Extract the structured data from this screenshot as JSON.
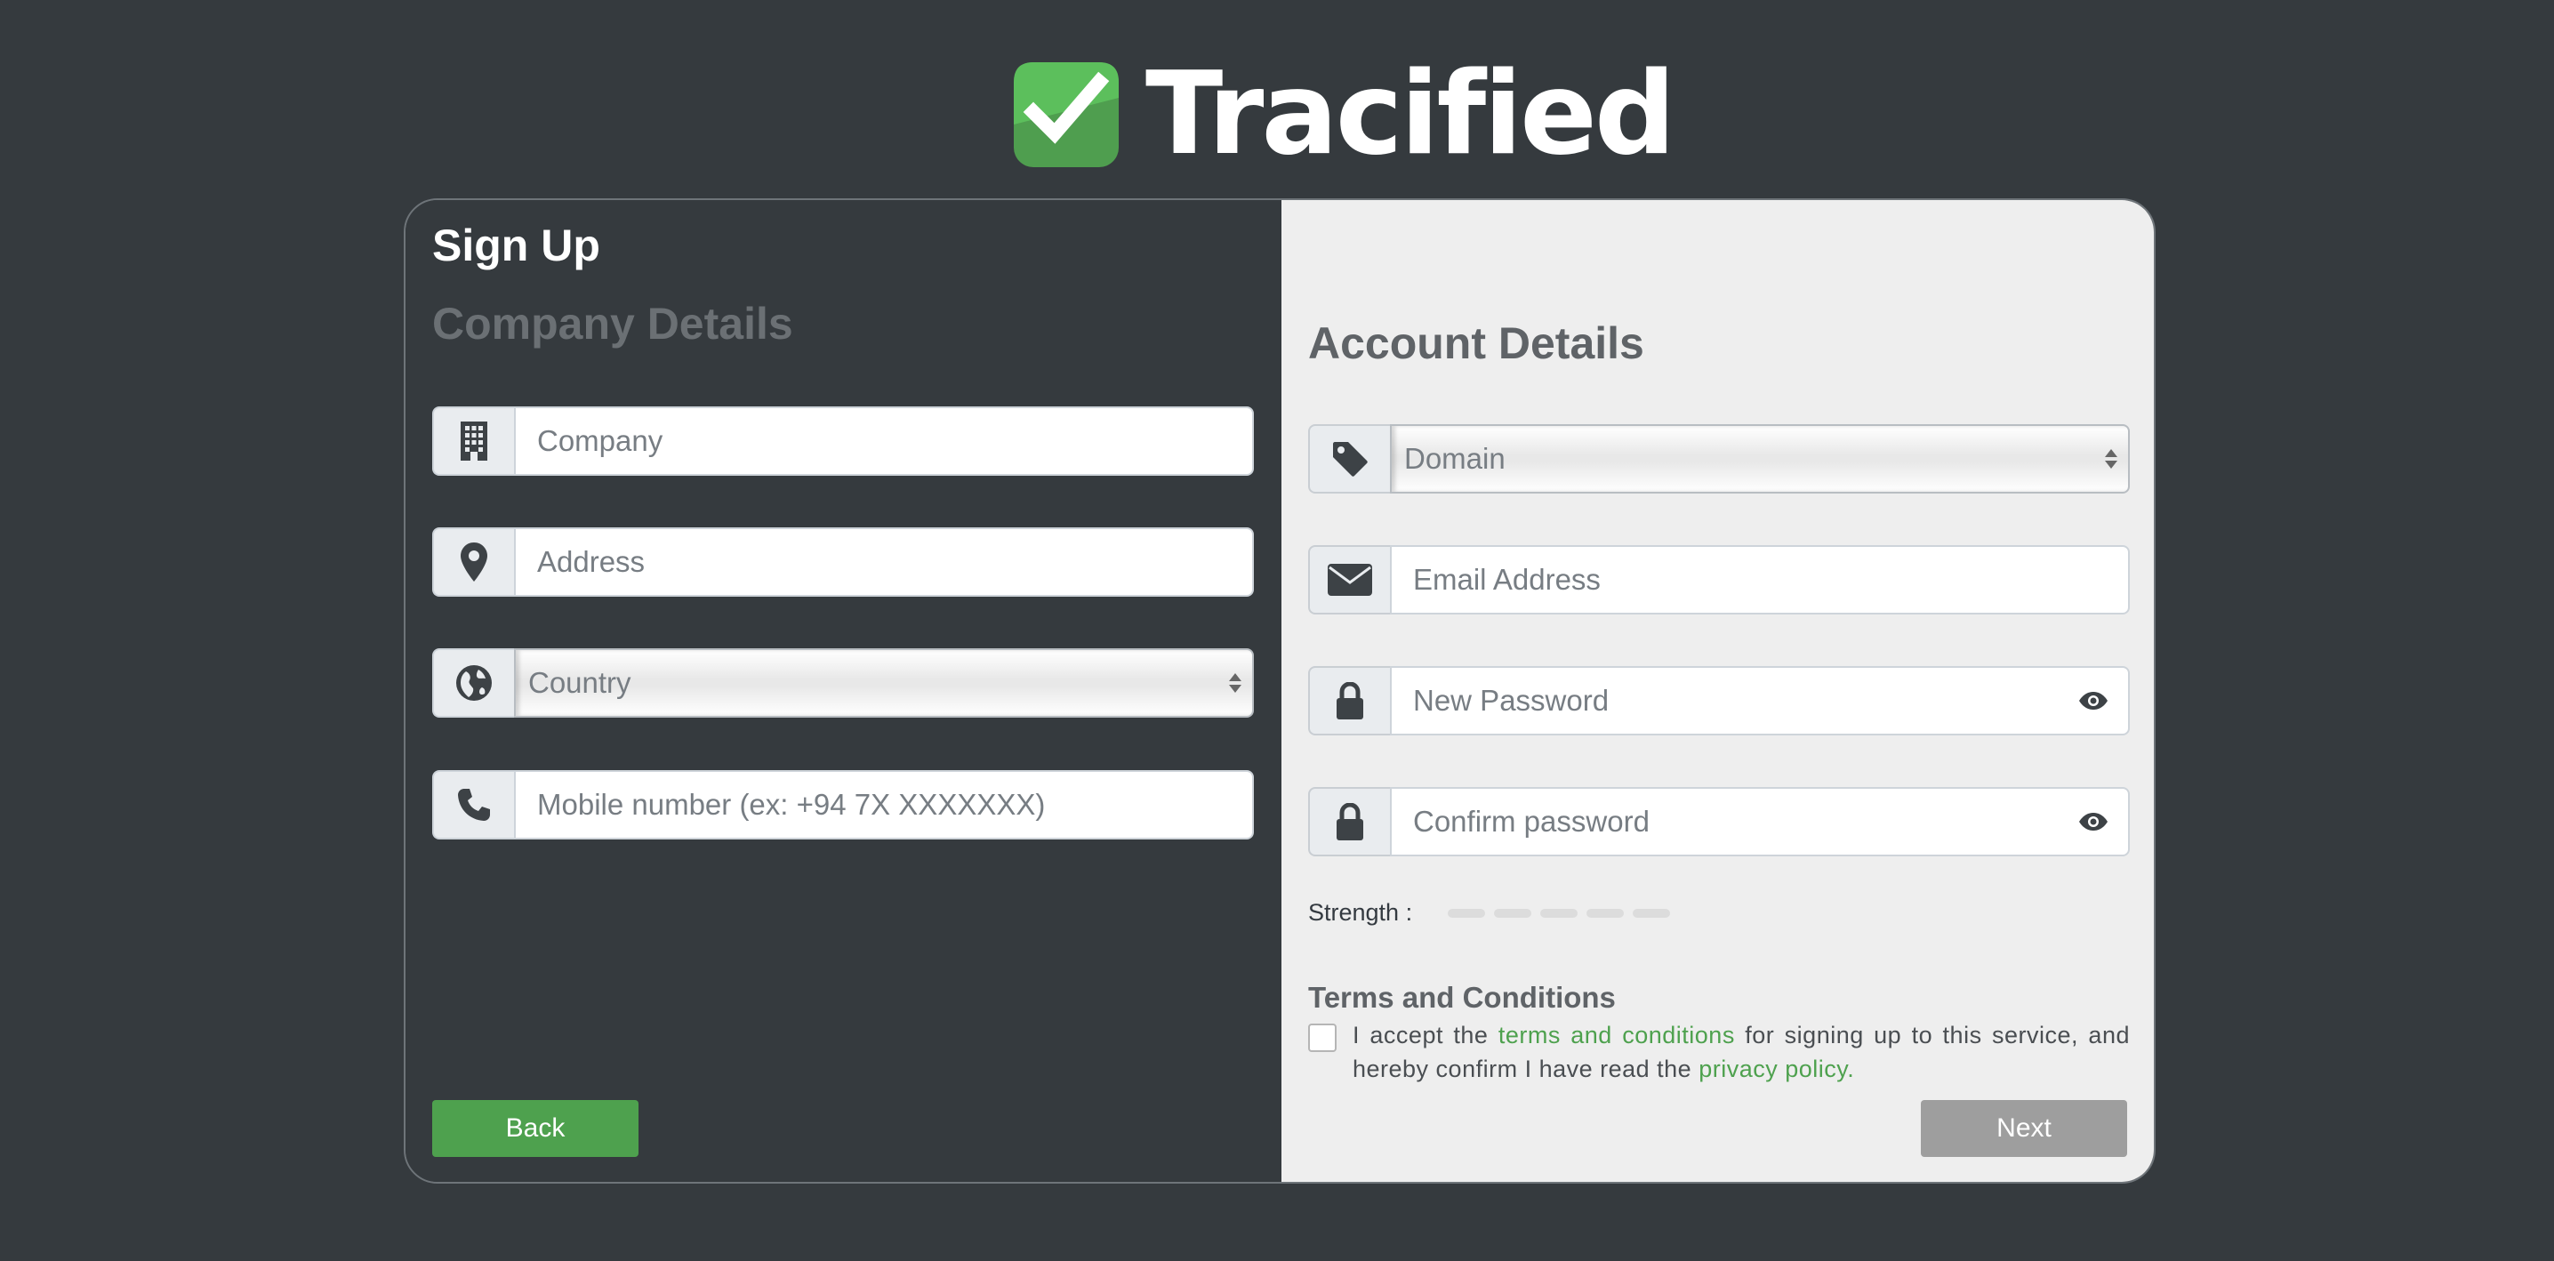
{
  "brand": {
    "name": "Tracified",
    "color": "#4ea14e"
  },
  "form": {
    "title": "Sign Up",
    "company_section": {
      "heading": "Company Details",
      "company_placeholder": "Company",
      "address_placeholder": "Address",
      "country_value": "Country",
      "mobile_placeholder": "Mobile number (ex: +94 7X XXXXXXX)"
    },
    "account_section": {
      "heading": "Account Details",
      "domain_value": "Domain",
      "email_placeholder": "Email Address",
      "password_placeholder": "New Password",
      "confirm_placeholder": "Confirm password",
      "strength_label": "Strength :",
      "strength_level": 0
    },
    "terms": {
      "heading": "Terms and Conditions",
      "text_1": "I accept the",
      "terms_link": "terms and conditions",
      "text_2": "for signing up to this service, and hereby confirm I have read the",
      "privacy_link": "privacy policy."
    },
    "buttons": {
      "back": "Back",
      "next": "Next"
    }
  },
  "icons": {
    "company": "building-icon",
    "address": "map-marker-icon",
    "country": "globe-icon",
    "mobile": "phone-icon",
    "domain": "tag-icon",
    "email": "envelope-icon",
    "password": "lock-icon",
    "show_password": "eye-icon"
  }
}
